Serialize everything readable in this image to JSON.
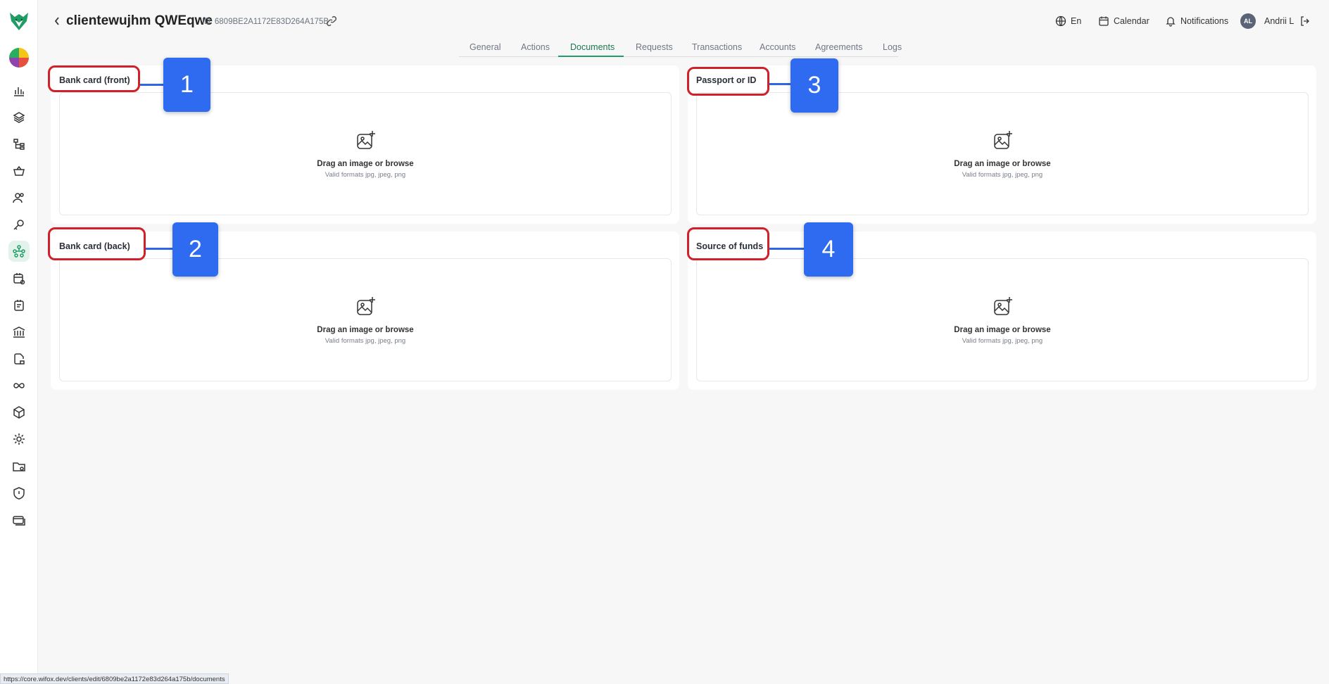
{
  "header": {
    "client_name": "clientewujhm QWEqwe",
    "client_id": "ID: 6809BE2A1172E83D264A175B"
  },
  "top_right": {
    "language": "En",
    "calendar": "Calendar",
    "notifications": "Notifications",
    "avatar_initials": "AL",
    "user_name": "Andrii L"
  },
  "tabs": [
    {
      "label": "General"
    },
    {
      "label": "Actions"
    },
    {
      "label": "Documents"
    },
    {
      "label": "Requests"
    },
    {
      "label": "Transactions"
    },
    {
      "label": "Accounts"
    },
    {
      "label": "Agreements"
    },
    {
      "label": "Logs"
    }
  ],
  "active_tab": "Documents",
  "documents": [
    {
      "title": "Bank card (front)",
      "drop_text": "Drag an image or browse",
      "formats": "Valid formats jpg, jpeg, png",
      "badge": "1"
    },
    {
      "title": "Passport or ID",
      "drop_text": "Drag an image or browse",
      "formats": "Valid formats jpg, jpeg, png",
      "badge": "3"
    },
    {
      "title": "Bank card (back)",
      "drop_text": "Drag an image or browse",
      "formats": "Valid formats jpg, jpeg, png",
      "badge": "2"
    },
    {
      "title": "Source of funds",
      "drop_text": "Drag an image or browse",
      "formats": "Valid formats jpg, jpeg, png",
      "badge": "4"
    }
  ],
  "status_url": "https://core.wifox.dev/clients/edit/6809be2a1172e83d264a175b/documents",
  "colors": {
    "accent": "#1f9d66",
    "annotation_red": "#d0202a",
    "annotation_blue": "#2f6bf0"
  }
}
